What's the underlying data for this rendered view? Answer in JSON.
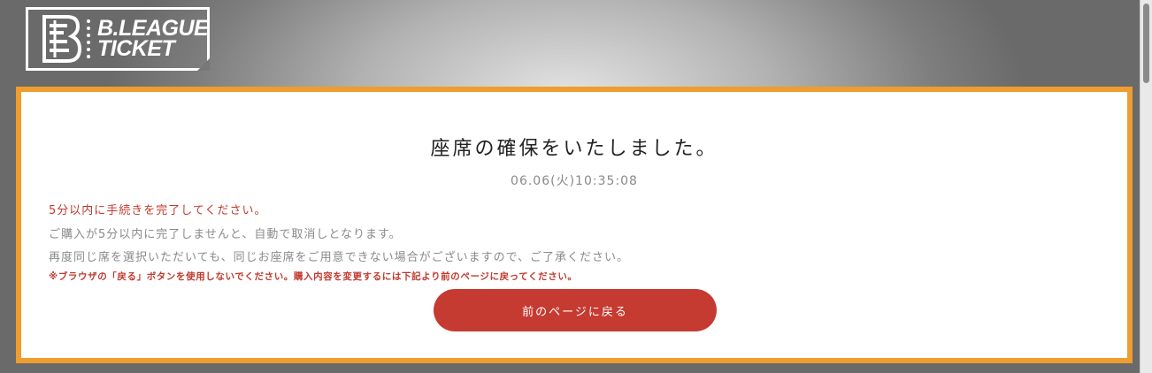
{
  "logo": {
    "line1": "B.LEAGUE",
    "line2": "TICKET",
    "mark_icon": "bleague-logo-mark"
  },
  "panel": {
    "title": "座席の確保をいたしました。",
    "timestamp": "06.06(火)10:35:08",
    "messages": {
      "deadline": "5分以内に手続きを完了してください。",
      "auto_cancel": "ご購入が5分以内に完了しませんと、自動で取消しとなります。",
      "reselect_notice": "再度同じ席を選択いただいても、同じお座席をご用意できない場合がございますので、ご了承ください。",
      "browser_back_warning": "※ブラウザの「戻る」ボタンを使用しないでください。購入内容を変更するには下記より前のページに戻ってください。"
    },
    "back_button_label": "前のページに戻る"
  },
  "colors": {
    "accent_border": "#ee9d2e",
    "warning_text": "#c13a2f",
    "button_bg": "#c53a31"
  }
}
